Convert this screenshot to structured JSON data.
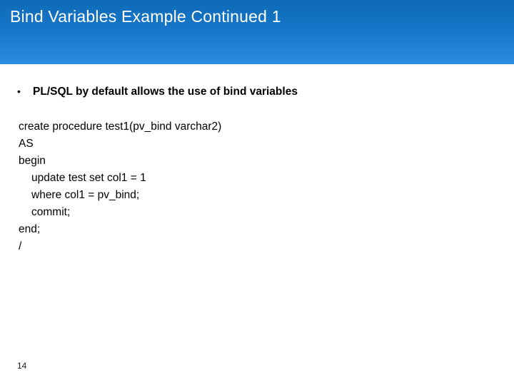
{
  "slide": {
    "title": "Bind Variables Example Continued 1",
    "page_number": "14"
  },
  "bullet": {
    "marker": "•",
    "text": "PL/SQL by default allows the use of bind variables"
  },
  "code": {
    "line1": "create procedure test1(pv_bind varchar2)",
    "line2": "AS",
    "line3": "begin",
    "line4": "update test set col1 = 1",
    "line5": "where col1 = pv_bind;",
    "line6": "commit;",
    "line7": "end;",
    "line8": "/"
  }
}
